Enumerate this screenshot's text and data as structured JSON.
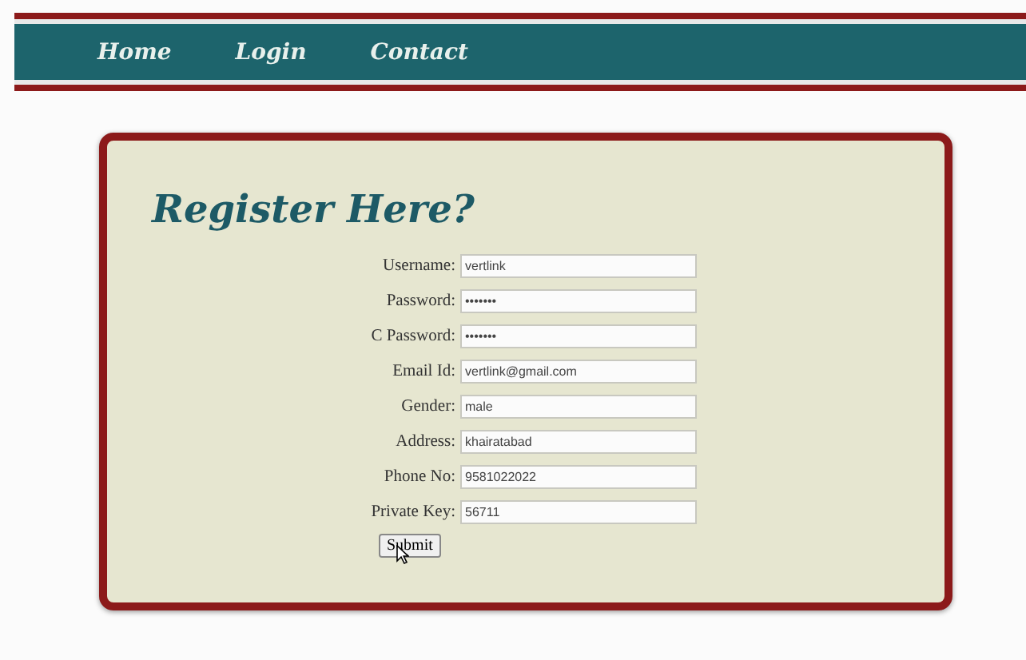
{
  "nav": {
    "items": [
      {
        "label": "Home"
      },
      {
        "label": "Login"
      },
      {
        "label": "Contact"
      }
    ]
  },
  "form": {
    "title": "Register Here?",
    "fields": [
      {
        "label": "Username:",
        "value": "vertlink"
      },
      {
        "label": "Password:",
        "value": "•••••••"
      },
      {
        "label": "C Password:",
        "value": "•••••••"
      },
      {
        "label": "Email Id:",
        "value": "vertlink@gmail.com"
      },
      {
        "label": "Gender:",
        "value": "male"
      },
      {
        "label": "Address:",
        "value": "khairatabad"
      },
      {
        "label": "Phone No:",
        "value": "9581022022"
      },
      {
        "label": "Private Key:",
        "value": "56711"
      }
    ],
    "submit": "Submit"
  }
}
